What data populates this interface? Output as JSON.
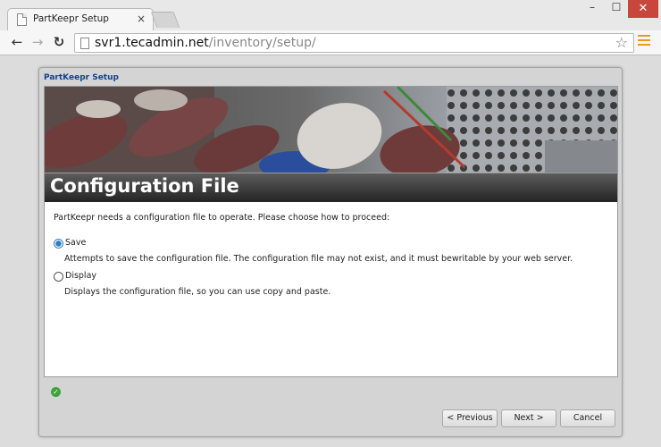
{
  "browser": {
    "tab_title": "PartKeepr Setup",
    "tab_close": "×",
    "url_host": "svr1.tecadmin.net",
    "url_path": "/inventory/setup/",
    "window_controls": {
      "minimize": "–",
      "maximize": "☐",
      "close": "✕"
    }
  },
  "wizard": {
    "title": "PartKeepr Setup",
    "heading": "Configuration File",
    "intro": "PartKeepr needs a configuration file to operate. Please choose how to proceed:",
    "options": [
      {
        "label": "Save",
        "description": "Attempts to save the configuration file. The configuration file may not exist, and it must bewritable by your web server.",
        "checked": true
      },
      {
        "label": "Display",
        "description": "Displays the configuration file, so you can use copy and paste.",
        "checked": false
      }
    ],
    "buttons": {
      "previous": "< Previous",
      "next": "Next >",
      "cancel": "Cancel"
    }
  },
  "colors": {
    "accent": "#2f7dc0",
    "title_text": "#15428b",
    "close_button": "#c9463d",
    "menu_icon": "#e79a1b",
    "status_ok": "#3ea33b"
  },
  "icons": [
    "page-icon",
    "star-icon",
    "menu-icon",
    "back-arrow-icon",
    "forward-arrow-icon",
    "reload-icon",
    "check-icon"
  ]
}
